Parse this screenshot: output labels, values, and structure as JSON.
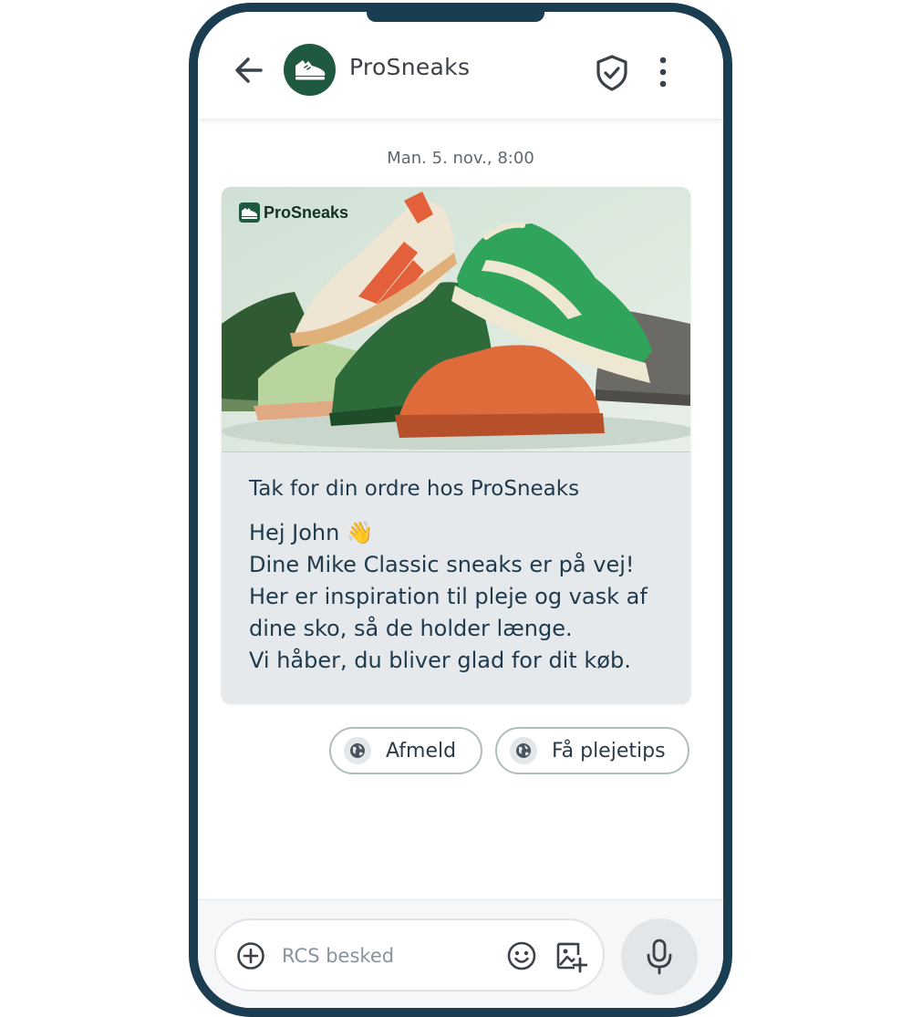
{
  "header": {
    "back_icon": "arrow-left-icon",
    "avatar_icon": "sneaker-icon",
    "brand_name": "ProSneaks",
    "verified_icon": "shield-check-icon",
    "menu_icon": "more-vertical-icon"
  },
  "conversation": {
    "timestamp": "Man. 5. nov., 8:00",
    "rich_card": {
      "image": {
        "logo_text": "ProSneaks",
        "description_icon": "sneakers-product-photo"
      },
      "title": "Tak for din ordre hos ProSneaks",
      "body_lines": [
        "Hej John 👋",
        "Dine Mike Classic sneaks er på vej!",
        "Her er inspiration til pleje og vask af",
        "dine sko, så de holder længe.",
        "Vi håber, du bliver glad for dit køb."
      ]
    },
    "suggestions": [
      {
        "label": "Afmeld",
        "icon": "globe-icon"
      },
      {
        "label": "Få plejetips",
        "icon": "globe-icon"
      }
    ]
  },
  "composer": {
    "add_icon": "plus-circle-icon",
    "placeholder": "RCS besked",
    "emoji_icon": "emoji-icon",
    "gallery_icon": "add-image-icon",
    "mic_icon": "microphone-icon"
  },
  "colors": {
    "frame": "#1b3d52",
    "brand_green": "#1f5a40",
    "card_bg": "#e6e9ec",
    "text_dark": "#1f3a4c"
  }
}
